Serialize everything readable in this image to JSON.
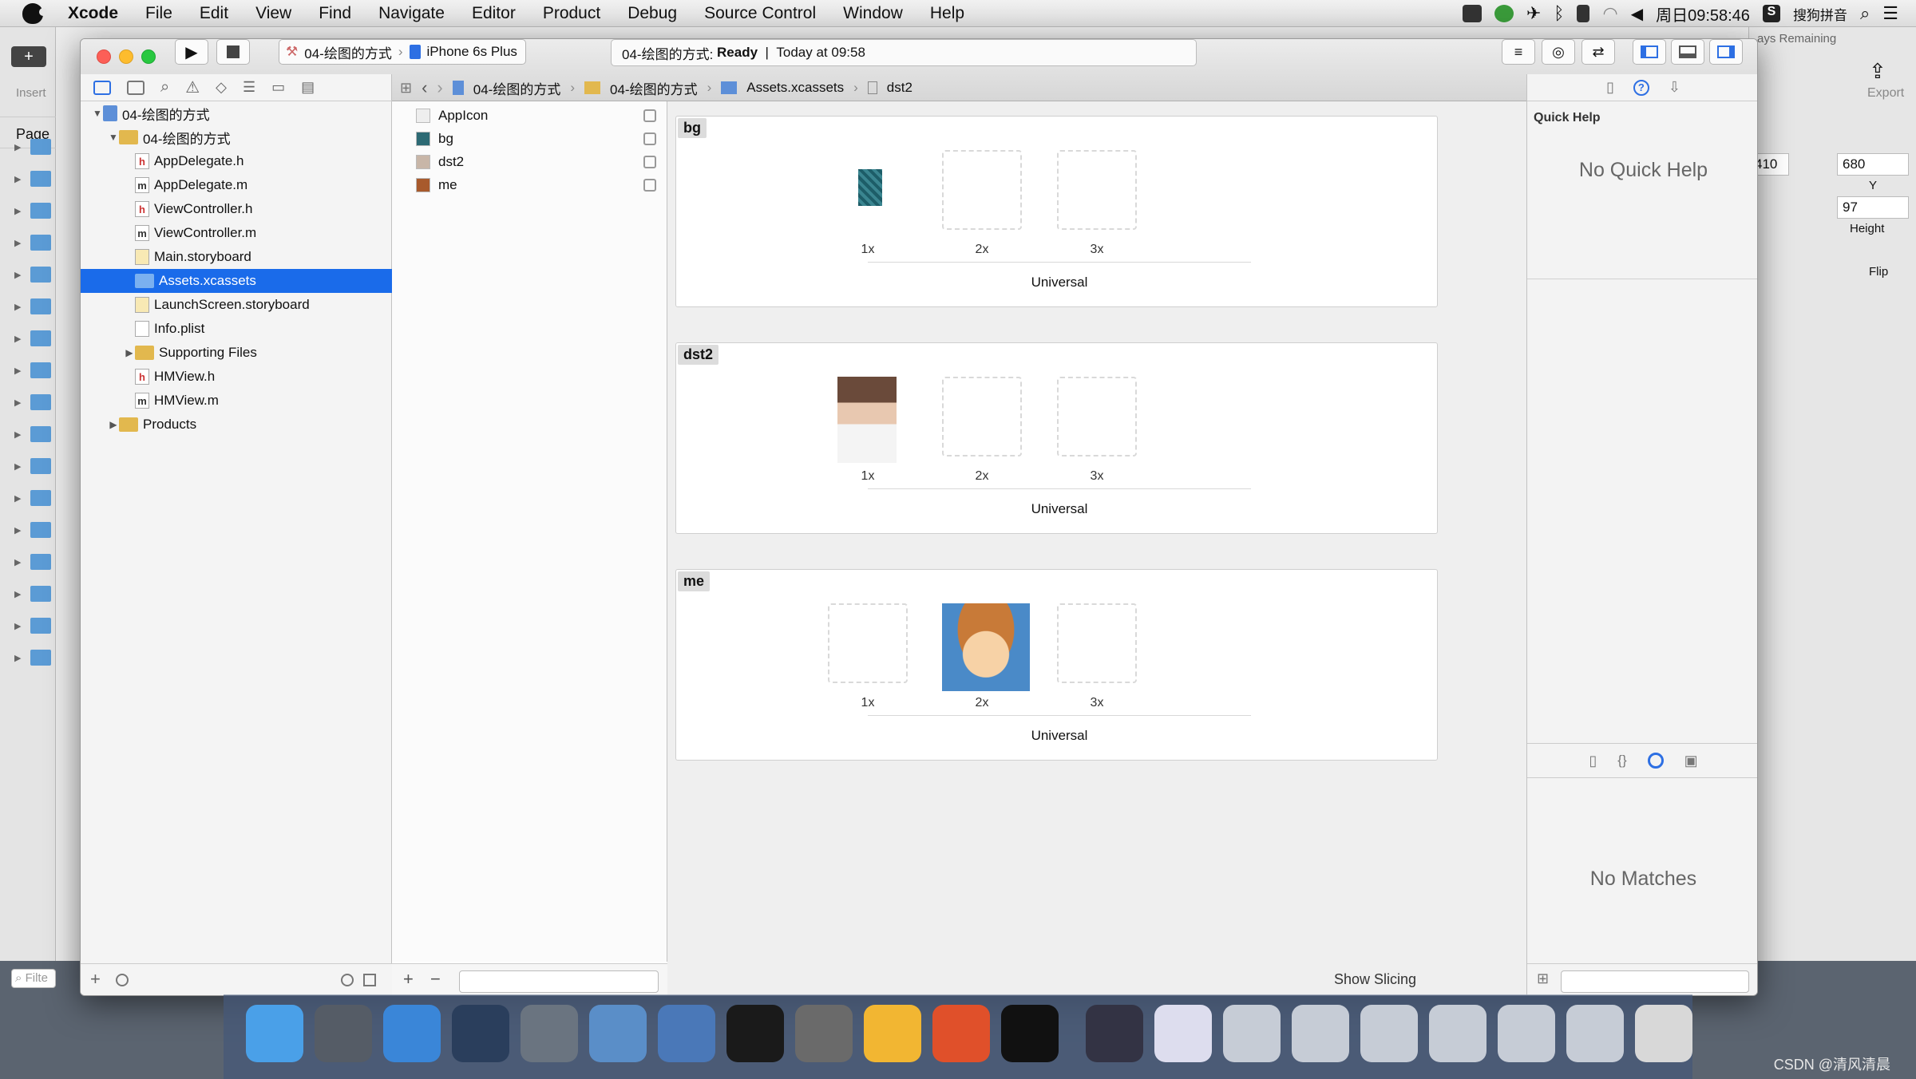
{
  "menubar": {
    "items": [
      "Xcode",
      "File",
      "Edit",
      "View",
      "Find",
      "Navigate",
      "Editor",
      "Product",
      "Debug",
      "Source Control",
      "Window",
      "Help"
    ],
    "clock": "周日09:58:46",
    "input_method": "搜狗拼音"
  },
  "ib": {
    "insert": "Insert",
    "page": "Page",
    "remaining": "ays Remaining",
    "export": "Export",
    "x_value": "410",
    "y_value": "680",
    "y_label": "Y",
    "height_value": "97",
    "height_label": "Height",
    "flip_label": "Flip",
    "filter_placeholder": "Filte"
  },
  "toolbar": {
    "scheme": "04-绘图的方式",
    "device": "iPhone 6s Plus",
    "activity_project": "04-绘图的方式:",
    "activity_status": "Ready",
    "activity_sep": "|",
    "activity_time": "Today at 09:58"
  },
  "jumpbar": [
    "04-绘图的方式",
    "04-绘图的方式",
    "Assets.xcassets",
    "dst2"
  ],
  "navigator": {
    "rows": [
      {
        "label": "04-绘图的方式",
        "icon": "project",
        "indent": 0,
        "disc": "▼"
      },
      {
        "label": "04-绘图的方式",
        "icon": "folder",
        "indent": 1,
        "disc": "▼"
      },
      {
        "label": "AppDelegate.h",
        "icon": "h",
        "indent": 2,
        "disc": ""
      },
      {
        "label": "AppDelegate.m",
        "icon": "m",
        "indent": 2,
        "disc": ""
      },
      {
        "label": "ViewController.h",
        "icon": "h",
        "indent": 2,
        "disc": ""
      },
      {
        "label": "ViewController.m",
        "icon": "m",
        "indent": 2,
        "disc": ""
      },
      {
        "label": "Main.storyboard",
        "icon": "sb",
        "indent": 2,
        "disc": ""
      },
      {
        "label": "Assets.xcassets",
        "icon": "assets",
        "indent": 2,
        "disc": "",
        "selected": true
      },
      {
        "label": "LaunchScreen.storyboard",
        "icon": "sb",
        "indent": 2,
        "disc": ""
      },
      {
        "label": "Info.plist",
        "icon": "plist",
        "indent": 2,
        "disc": ""
      },
      {
        "label": "Supporting Files",
        "icon": "folder",
        "indent": 2,
        "disc": "▶"
      },
      {
        "label": "HMView.h",
        "icon": "h",
        "indent": 2,
        "disc": ""
      },
      {
        "label": "HMView.m",
        "icon": "m",
        "indent": 2,
        "disc": ""
      },
      {
        "label": "Products",
        "icon": "folder",
        "indent": 1,
        "disc": "▶"
      }
    ]
  },
  "asset_list": [
    "AppIcon",
    "bg",
    "dst2",
    "me"
  ],
  "asset_sets": [
    {
      "name": "bg",
      "filled": "1x"
    },
    {
      "name": "dst2",
      "filled": "1x"
    },
    {
      "name": "me",
      "filled": "2x"
    }
  ],
  "scales": [
    "1x",
    "2x",
    "3x"
  ],
  "universal": "Universal",
  "show_slicing": "Show Slicing",
  "inspector": {
    "title": "Quick Help",
    "no_help": "No Quick Help",
    "no_matches": "No Matches"
  },
  "bottom": {
    "add": "+",
    "remove": "−"
  },
  "watermark": "CSDN @清风清晨"
}
